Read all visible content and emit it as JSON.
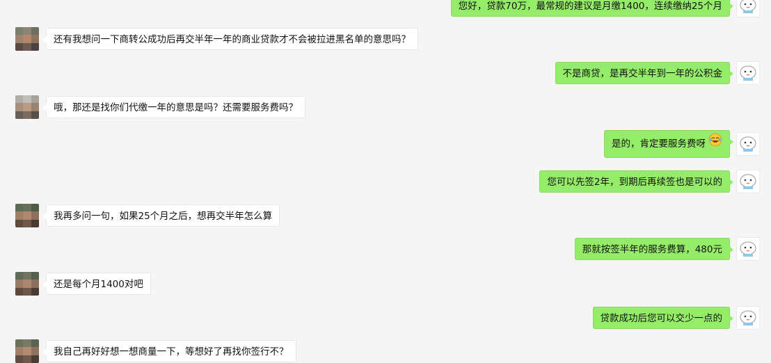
{
  "messages": [
    {
      "side": "right",
      "text": "您好，贷款70万，最常规的建议是月缴1400，连续缴纳25个月"
    },
    {
      "side": "left",
      "text": "还有我想问一下商转公成功后再交半年一年的商业贷款才不会被拉进黑名单的意思吗？"
    },
    {
      "side": "right",
      "text": "不是商贷，是再交半年到一年的公积金"
    },
    {
      "side": "left",
      "text": "哦，那还是找你们代缴一年的意思是吗？还需要服务费吗？"
    },
    {
      "side": "right",
      "text": "是的，肯定要服务费呀",
      "emoji": "laughing-tears-emoji"
    },
    {
      "side": "right",
      "text": "您可以先签2年，到期后再续签也是可以的"
    },
    {
      "side": "left",
      "text": "我再多问一句，如果25个月之后，想再交半年怎么算"
    },
    {
      "side": "right",
      "text": "那就按签半年的服务费算，480元"
    },
    {
      "side": "left",
      "text": "还是每个月1400对吧"
    },
    {
      "side": "right",
      "text": "贷款成功后您可以交少一点的"
    },
    {
      "side": "left",
      "text": "我自己再好好想一想商量一下，等想好了再找你签行不？"
    }
  ],
  "colors": {
    "background": "#f5f5f5",
    "self_bubble": "#95ec69",
    "other_bubble": "#ffffff"
  },
  "icons": {
    "contact_avatar": "pixelated-avatar",
    "self_avatar": "cartoon-cat-avatar"
  }
}
